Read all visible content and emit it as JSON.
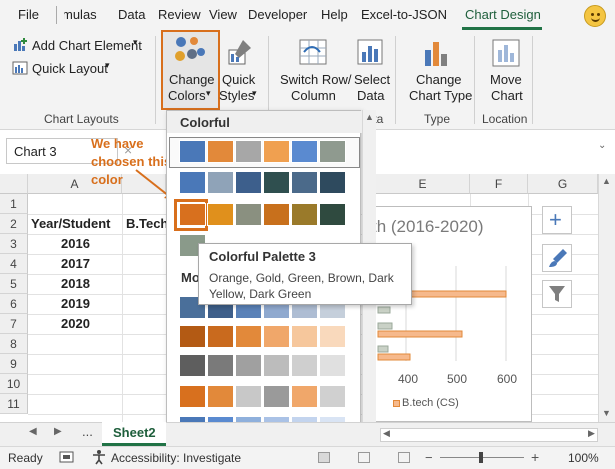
{
  "ribbon_tabs": [
    "File",
    "mulas",
    "Data",
    "Review",
    "View",
    "Developer",
    "Help",
    "Excel-to-JSON",
    "Chart Design"
  ],
  "ribbon": {
    "add_chart_element": "Add Chart Element",
    "quick_layout": "Quick Layout",
    "chart_layouts_label": "Chart Layouts",
    "change_colors_line1": "Change",
    "change_colors_line2": "Colors",
    "quick_styles_line1": "Quick",
    "quick_styles_line2": "Styles",
    "switch_row_line1": "Switch Row/",
    "switch_row_line2": "Column",
    "select_data_line1": "Select",
    "select_data_line2": "Data",
    "data_label": "Data",
    "change_type_line1": "Change",
    "change_type_line2": "Chart Type",
    "type_label": "Type",
    "move_chart_line1": "Move",
    "move_chart_line2": "Chart",
    "location_label": "Location"
  },
  "name_box": "Chart 3",
  "columns": [
    "A",
    "E",
    "F",
    "G"
  ],
  "rows": [
    "1",
    "2",
    "3",
    "4",
    "5",
    "6",
    "7",
    "8",
    "9",
    "10",
    "11"
  ],
  "cells": {
    "a2": "Year/Student",
    "b2": "B.Tech",
    "years": [
      "2016",
      "2017",
      "2018",
      "2019",
      "2020"
    ]
  },
  "chart": {
    "title": "th (2016-2020)",
    "ticks": [
      "400",
      "500",
      "600"
    ],
    "legend": "B.tech (CS)"
  },
  "palette": {
    "section_colorful": "Colorful",
    "section_mono": "Mo",
    "tooltip_title": "Colorful Palette 3",
    "tooltip_body": "Orange, Gold, Green, Brown, Dark Yellow, Dark Green"
  },
  "annotation": [
    "We have",
    "choosen this",
    "color"
  ],
  "sheet_tab": "Sheet2",
  "sheet_nav": "...",
  "status": {
    "ready": "Ready",
    "accessibility": "Accessibility: Investigate",
    "zoom": "100%"
  },
  "colors": {
    "accent": "#217346",
    "highlight": "#d86f1c"
  }
}
